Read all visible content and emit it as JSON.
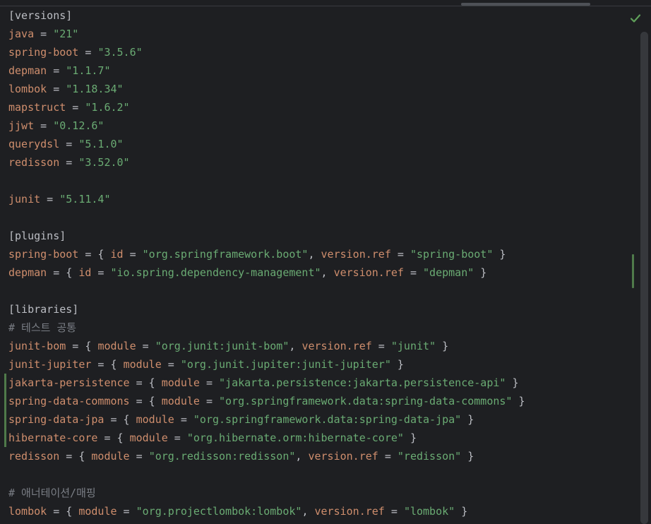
{
  "editor": {
    "inspection_status": "no-problems-check-icon",
    "lines": [
      {
        "changed": false,
        "tokens": [
          {
            "k": "t",
            "v": "[versions]"
          }
        ]
      },
      {
        "changed": false,
        "tokens": [
          {
            "k": "k",
            "v": "java"
          },
          {
            "k": "p",
            "v": " = "
          },
          {
            "k": "s",
            "v": "\"21\""
          }
        ]
      },
      {
        "changed": false,
        "tokens": [
          {
            "k": "k",
            "v": "spring-boot"
          },
          {
            "k": "p",
            "v": " = "
          },
          {
            "k": "s",
            "v": "\"3.5.6\""
          }
        ]
      },
      {
        "changed": false,
        "tokens": [
          {
            "k": "k",
            "v": "depman"
          },
          {
            "k": "p",
            "v": " = "
          },
          {
            "k": "s",
            "v": "\"1.1.7\""
          }
        ]
      },
      {
        "changed": false,
        "tokens": [
          {
            "k": "k",
            "v": "lombok"
          },
          {
            "k": "p",
            "v": " = "
          },
          {
            "k": "s",
            "v": "\"1.18.34\""
          }
        ]
      },
      {
        "changed": false,
        "tokens": [
          {
            "k": "k",
            "v": "mapstruct"
          },
          {
            "k": "p",
            "v": " = "
          },
          {
            "k": "s",
            "v": "\"1.6.2\""
          }
        ]
      },
      {
        "changed": false,
        "tokens": [
          {
            "k": "k",
            "v": "jjwt"
          },
          {
            "k": "p",
            "v": " = "
          },
          {
            "k": "s",
            "v": "\"0.12.6\""
          }
        ]
      },
      {
        "changed": false,
        "tokens": [
          {
            "k": "k",
            "v": "querydsl"
          },
          {
            "k": "p",
            "v": " = "
          },
          {
            "k": "s",
            "v": "\"5.1.0\""
          }
        ]
      },
      {
        "changed": false,
        "tokens": [
          {
            "k": "k",
            "v": "redisson"
          },
          {
            "k": "p",
            "v": " = "
          },
          {
            "k": "s",
            "v": "\"3.52.0\""
          }
        ]
      },
      {
        "changed": false,
        "tokens": []
      },
      {
        "changed": false,
        "tokens": [
          {
            "k": "k",
            "v": "junit"
          },
          {
            "k": "p",
            "v": " = "
          },
          {
            "k": "s",
            "v": "\"5.11.4\""
          }
        ]
      },
      {
        "changed": false,
        "tokens": []
      },
      {
        "changed": false,
        "tokens": [
          {
            "k": "t",
            "v": "[plugins]"
          }
        ]
      },
      {
        "changed": false,
        "tokens": [
          {
            "k": "k",
            "v": "spring-boot"
          },
          {
            "k": "p",
            "v": " = { "
          },
          {
            "k": "k",
            "v": "id"
          },
          {
            "k": "p",
            "v": " = "
          },
          {
            "k": "s",
            "v": "\"org.springframework.boot\""
          },
          {
            "k": "p",
            "v": ", "
          },
          {
            "k": "k",
            "v": "version.ref"
          },
          {
            "k": "p",
            "v": " = "
          },
          {
            "k": "s",
            "v": "\"spring-boot\""
          },
          {
            "k": "p",
            "v": " }"
          }
        ]
      },
      {
        "changed": false,
        "tokens": [
          {
            "k": "k",
            "v": "depman"
          },
          {
            "k": "p",
            "v": " = { "
          },
          {
            "k": "k",
            "v": "id"
          },
          {
            "k": "p",
            "v": " = "
          },
          {
            "k": "s",
            "v": "\"io.spring.dependency-management\""
          },
          {
            "k": "p",
            "v": ", "
          },
          {
            "k": "k",
            "v": "version.ref"
          },
          {
            "k": "p",
            "v": " = "
          },
          {
            "k": "s",
            "v": "\"depman\""
          },
          {
            "k": "p",
            "v": " }"
          }
        ]
      },
      {
        "changed": false,
        "tokens": []
      },
      {
        "changed": false,
        "tokens": [
          {
            "k": "t",
            "v": "[libraries]"
          }
        ]
      },
      {
        "changed": false,
        "tokens": [
          {
            "k": "c",
            "v": "# 테스트 공통"
          }
        ]
      },
      {
        "changed": false,
        "tokens": [
          {
            "k": "k",
            "v": "junit-bom"
          },
          {
            "k": "p",
            "v": " = { "
          },
          {
            "k": "k",
            "v": "module"
          },
          {
            "k": "p",
            "v": " = "
          },
          {
            "k": "s",
            "v": "\"org.junit:junit-bom\""
          },
          {
            "k": "p",
            "v": ", "
          },
          {
            "k": "k",
            "v": "version.ref"
          },
          {
            "k": "p",
            "v": " = "
          },
          {
            "k": "s",
            "v": "\"junit\""
          },
          {
            "k": "p",
            "v": " }"
          }
        ]
      },
      {
        "changed": false,
        "tokens": [
          {
            "k": "k",
            "v": "junit-jupiter"
          },
          {
            "k": "p",
            "v": " = { "
          },
          {
            "k": "k",
            "v": "module"
          },
          {
            "k": "p",
            "v": " = "
          },
          {
            "k": "s",
            "v": "\"org.junit.jupiter:junit-jupiter\""
          },
          {
            "k": "p",
            "v": " }"
          }
        ]
      },
      {
        "changed": true,
        "tokens": [
          {
            "k": "k",
            "v": "jakarta-persistence"
          },
          {
            "k": "p",
            "v": " = { "
          },
          {
            "k": "k",
            "v": "module"
          },
          {
            "k": "p",
            "v": " = "
          },
          {
            "k": "s",
            "v": "\"jakarta.persistence:jakarta.persistence-api\""
          },
          {
            "k": "p",
            "v": " }"
          }
        ]
      },
      {
        "changed": true,
        "tokens": [
          {
            "k": "k",
            "v": "spring-data-commons"
          },
          {
            "k": "p",
            "v": " = { "
          },
          {
            "k": "k",
            "v": "module"
          },
          {
            "k": "p",
            "v": " = "
          },
          {
            "k": "s",
            "v": "\"org.springframework.data:spring-data-commons\""
          },
          {
            "k": "p",
            "v": " }"
          }
        ]
      },
      {
        "changed": true,
        "tokens": [
          {
            "k": "k",
            "v": "spring-data-jpa"
          },
          {
            "k": "p",
            "v": " = { "
          },
          {
            "k": "k",
            "v": "module"
          },
          {
            "k": "p",
            "v": " = "
          },
          {
            "k": "s",
            "v": "\"org.springframework.data:spring-data-jpa\""
          },
          {
            "k": "p",
            "v": " }"
          }
        ]
      },
      {
        "changed": true,
        "tokens": [
          {
            "k": "k",
            "v": "hibernate-core"
          },
          {
            "k": "p",
            "v": " = { "
          },
          {
            "k": "k",
            "v": "module"
          },
          {
            "k": "p",
            "v": " = "
          },
          {
            "k": "s",
            "v": "\"org.hibernate.orm:hibernate-core\""
          },
          {
            "k": "p",
            "v": " }"
          }
        ]
      },
      {
        "changed": false,
        "tokens": [
          {
            "k": "k",
            "v": "redisson"
          },
          {
            "k": "p",
            "v": " = { "
          },
          {
            "k": "k",
            "v": "module"
          },
          {
            "k": "p",
            "v": " = "
          },
          {
            "k": "s",
            "v": "\"org.redisson:redisson\""
          },
          {
            "k": "p",
            "v": ", "
          },
          {
            "k": "k",
            "v": "version.ref"
          },
          {
            "k": "p",
            "v": " = "
          },
          {
            "k": "s",
            "v": "\"redisson\""
          },
          {
            "k": "p",
            "v": " }"
          }
        ]
      },
      {
        "changed": false,
        "tokens": []
      },
      {
        "changed": false,
        "tokens": [
          {
            "k": "c",
            "v": "# 애너테이션/매핑"
          }
        ]
      },
      {
        "changed": false,
        "tokens": [
          {
            "k": "k",
            "v": "lombok"
          },
          {
            "k": "p",
            "v": " = { "
          },
          {
            "k": "k",
            "v": "module"
          },
          {
            "k": "p",
            "v": " = "
          },
          {
            "k": "s",
            "v": "\"org.projectlombok:lombok\""
          },
          {
            "k": "p",
            "v": ", "
          },
          {
            "k": "k",
            "v": "version.ref"
          },
          {
            "k": "p",
            "v": " = "
          },
          {
            "k": "s",
            "v": "\"lombok\""
          },
          {
            "k": "p",
            "v": " }"
          }
        ]
      }
    ]
  }
}
